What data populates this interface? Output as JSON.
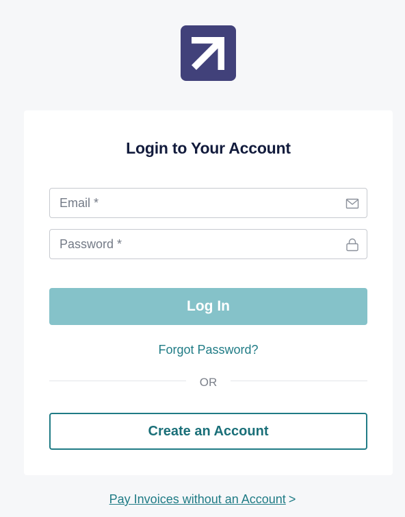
{
  "brand": {
    "logo_icon": "arrow-up-right-icon",
    "logo_color": "#41417a"
  },
  "login": {
    "title": "Login to Your Account",
    "email": {
      "placeholder": "Email *",
      "value": "",
      "icon": "envelope-icon"
    },
    "password": {
      "placeholder": "Password *",
      "value": "",
      "icon": "lock-icon"
    },
    "login_button": "Log In",
    "forgot_link": "Forgot Password?",
    "divider_text": "OR",
    "create_button": "Create an Account"
  },
  "footer": {
    "pay_link": "Pay Invoices without an Account",
    "pay_chevron": ">"
  },
  "colors": {
    "accent": "#1f7b85",
    "login_button_bg": "#85c2c9",
    "page_bg": "#f6f7f9",
    "title": "#121b3c"
  }
}
